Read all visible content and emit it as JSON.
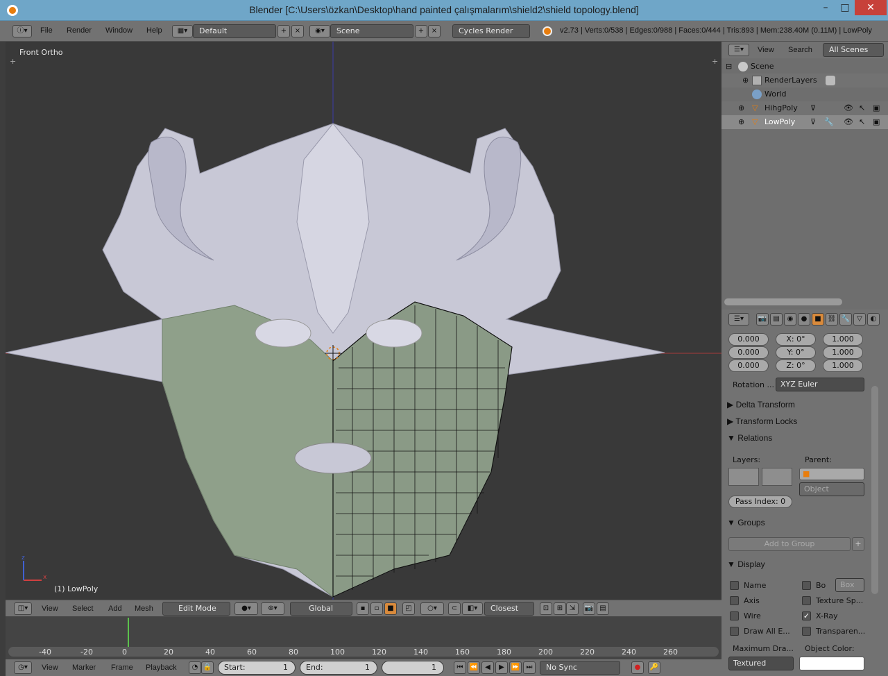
{
  "window": {
    "title": "Blender [C:\\Users\\özkan\\Desktop\\hand painted çalışmalarım\\shield2\\shield topology.blend]",
    "minimize": "–",
    "maximize": "□",
    "close": "✕"
  },
  "info_header": {
    "menus": [
      "File",
      "Render",
      "Window",
      "Help"
    ],
    "layout": "Default",
    "scene": "Scene",
    "engine": "Cycles Render",
    "stats": "v2.73 | Verts:0/538 | Edges:0/988 | Faces:0/444 | Tris:893 | Mem:238.40M (0.11M) | LowPoly"
  },
  "viewport": {
    "view_name": "Front Ortho",
    "object_label": "(1) LowPoly",
    "axis_x": "x",
    "axis_z": "z"
  },
  "view3d_header": {
    "menus": [
      "View",
      "Select",
      "Add",
      "Mesh"
    ],
    "mode": "Edit Mode",
    "orientation": "Global",
    "snap": "Closest"
  },
  "timeline": {
    "ticks": [
      "-40",
      "-20",
      "0",
      "20",
      "40",
      "60",
      "80",
      "100",
      "120",
      "140",
      "160",
      "180",
      "200",
      "220",
      "240",
      "260"
    ],
    "current_frame_marker": 0,
    "menus": [
      "View",
      "Marker",
      "Frame",
      "Playback"
    ],
    "start_label": "Start:",
    "start_value": "1",
    "end_label": "End:",
    "end_value": "1",
    "current": "1",
    "sync": "No Sync"
  },
  "outliner": {
    "menus": [
      "View",
      "Search"
    ],
    "filter": "All Scenes",
    "items": [
      {
        "label": "Scene"
      },
      {
        "label": "RenderLayers"
      },
      {
        "label": "World"
      },
      {
        "label": "HihgPoly"
      },
      {
        "label": "LowPoly"
      }
    ]
  },
  "properties": {
    "location": [
      "0.000",
      "0.000",
      "0.000"
    ],
    "rotation": [
      "X:  0°",
      "Y:  0°",
      "Z:  0°"
    ],
    "scale": [
      "1.000",
      "1.000",
      "1.000"
    ],
    "rotation_mode_label": "Rotation ...",
    "rotation_mode": "XYZ Euler",
    "panels": {
      "delta": "Delta Transform",
      "locks": "Transform Locks",
      "relations": "Relations",
      "groups": "Groups",
      "display": "Display"
    },
    "relations": {
      "layers": "Layers:",
      "parent": "Parent:",
      "parent_type": "Object",
      "pass_index": "Pass Index: 0"
    },
    "groups": {
      "add": "Add to Group"
    },
    "display": {
      "name": "Name",
      "bounds": "Bo",
      "bounds_type": "Box",
      "axis": "Axis",
      "texture_space": "Texture Sp...",
      "wire": "Wire",
      "xray": "X-Ray",
      "draw_all": "Draw All E...",
      "transparency": "Transparen...",
      "max_draw_label": "Maximum Dra...",
      "max_draw": "Textured",
      "object_color_label": "Object Color:"
    }
  },
  "colors": {
    "viewport_bg": "#393939",
    "header_bg": "#727272",
    "mesh_highpoly": "#c9c9d6",
    "mesh_lowpoly": "#8fa08a",
    "selection": "#e87d0d"
  }
}
